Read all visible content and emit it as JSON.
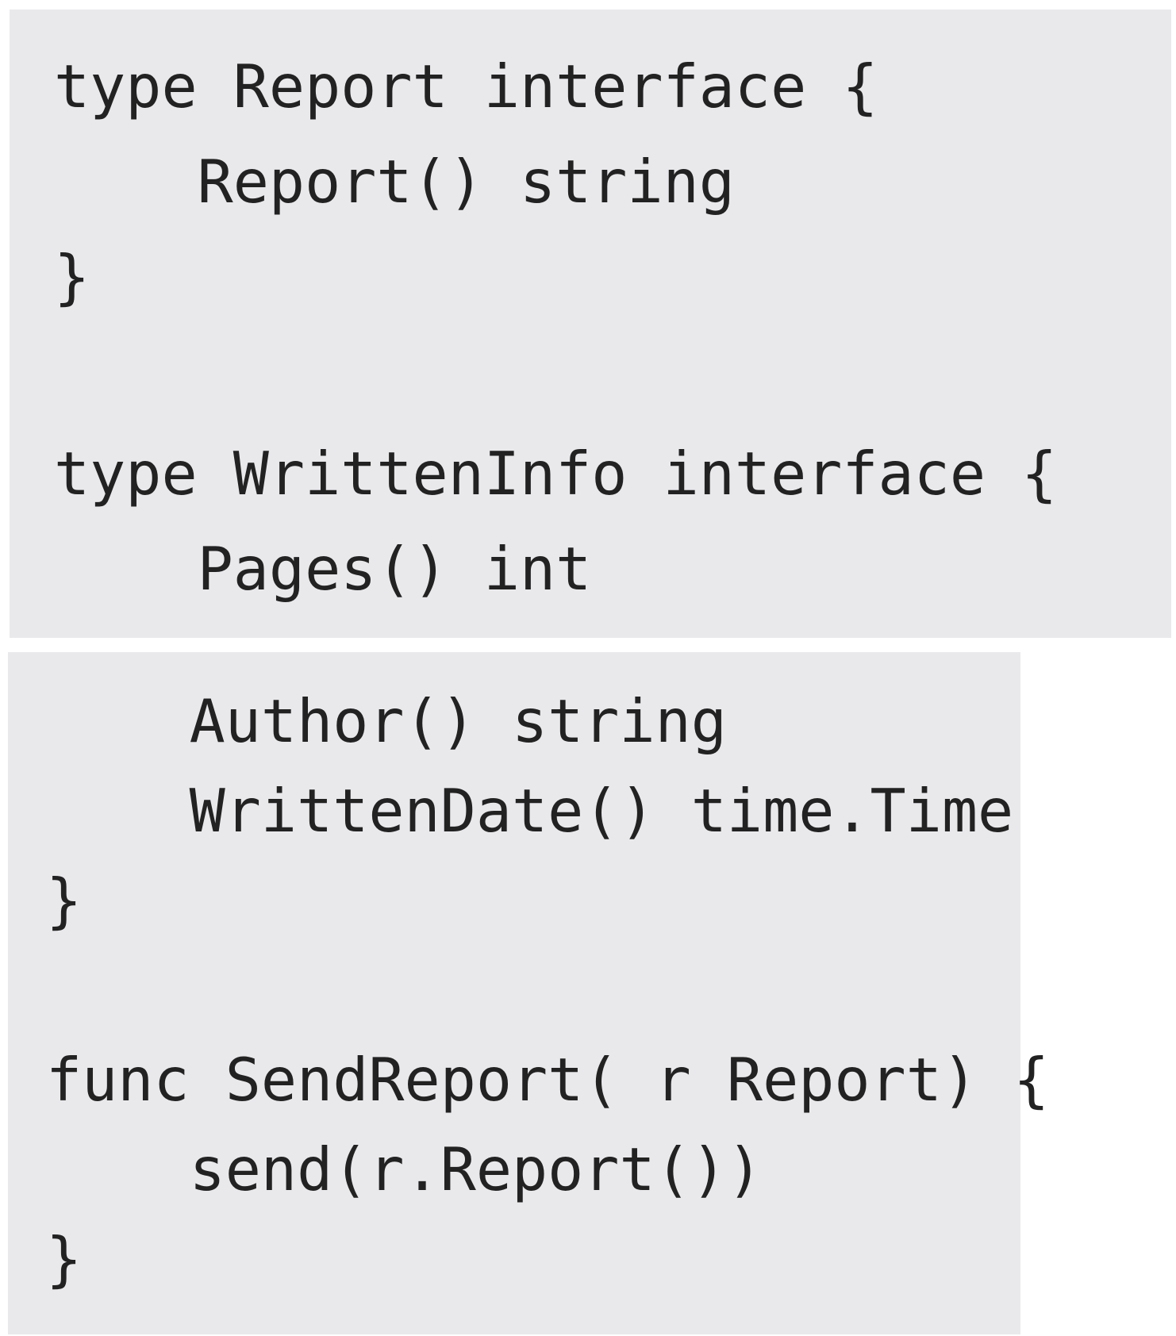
{
  "code_block_1": {
    "lines": [
      "type Report interface {",
      "    Report() string",
      "}",
      "",
      "type WrittenInfo interface {",
      "    Pages() int"
    ]
  },
  "code_block_2": {
    "lines": [
      "    Author() string",
      "    WrittenDate() time.Time",
      "}",
      "",
      "func SendReport( r Report) {",
      "    send(r.Report())",
      "}"
    ]
  }
}
